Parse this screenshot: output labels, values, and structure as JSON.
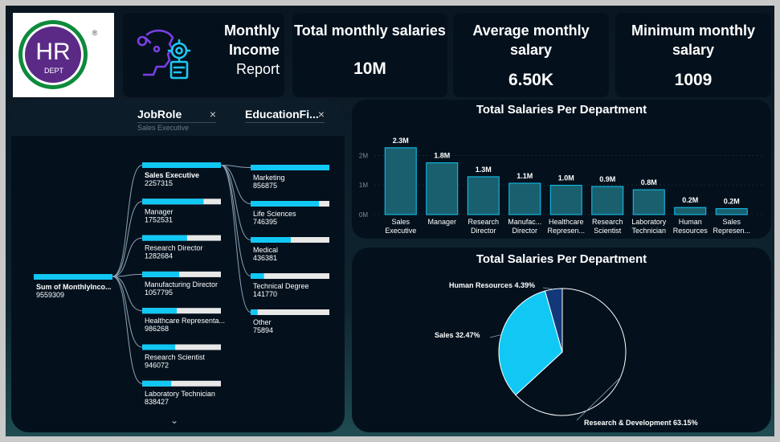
{
  "logo": {
    "text": "HR",
    "sub": "DEPT",
    "mark": "®"
  },
  "report_title": {
    "line1": "Monthly",
    "line2": "Income",
    "line3": "Report"
  },
  "kpis": [
    {
      "title_l1": "Total monthly salaries",
      "title_l2": "",
      "value": "10M"
    },
    {
      "title_l1": "Average monthly",
      "title_l2": "salary",
      "value": "6.50K"
    },
    {
      "title_l1": "Minimum monthly",
      "title_l2": "salary",
      "value": "1009"
    }
  ],
  "tree": {
    "col1_header": "JobRole",
    "col1_sub": "Sales Executive",
    "col2_header": "EducationFi...",
    "root": {
      "label": "Sum of MonthlyInco...",
      "value": "9559309"
    },
    "jobroles": [
      {
        "label": "Sales Executive",
        "value": "2257315",
        "fill": 1.0
      },
      {
        "label": "Manager",
        "value": "1752531",
        "fill": 0.78
      },
      {
        "label": "Research Director",
        "value": "1282684",
        "fill": 0.57
      },
      {
        "label": "Manufacturing Director",
        "value": "1057795",
        "fill": 0.47
      },
      {
        "label": "Healthcare Representa...",
        "value": "986268",
        "fill": 0.44
      },
      {
        "label": "Research Scientist",
        "value": "946072",
        "fill": 0.42
      },
      {
        "label": "Laboratory Technician",
        "value": "838427",
        "fill": 0.37
      }
    ],
    "education": [
      {
        "label": "Marketing",
        "value": "856875",
        "fill": 1.0
      },
      {
        "label": "Life Sciences",
        "value": "746395",
        "fill": 0.87
      },
      {
        "label": "Medical",
        "value": "436381",
        "fill": 0.51
      },
      {
        "label": "Technical Degree",
        "value": "141770",
        "fill": 0.17
      },
      {
        "label": "Other",
        "value": "75894",
        "fill": 0.09
      }
    ]
  },
  "chart_data": [
    {
      "type": "bar",
      "title": "Total Salaries Per Department",
      "categories": [
        [
          "Sales",
          "Executive"
        ],
        [
          "Manager"
        ],
        [
          "Research",
          "Director"
        ],
        [
          "Manufac...",
          "Director"
        ],
        [
          "Healthcare",
          "Represen..."
        ],
        [
          "Research",
          "Scientist"
        ],
        [
          "Laboratory",
          "Technician"
        ],
        [
          "Human",
          "Resources"
        ],
        [
          "Sales",
          "Represen..."
        ]
      ],
      "values": [
        2.26,
        1.75,
        1.28,
        1.06,
        0.99,
        0.95,
        0.84,
        0.24,
        0.2
      ],
      "data_labels": [
        "2.3M",
        "1.8M",
        "1.3M",
        "1.1M",
        "1.0M",
        "0.9M",
        "0.8M",
        "0.2M",
        "0.2M"
      ],
      "y_ticks": [
        "0M",
        "1M",
        "2M"
      ],
      "ylim": [
        0,
        2.5
      ]
    },
    {
      "type": "pie",
      "title": "Total Salaries Per Department",
      "slices": [
        {
          "label": "Research & Development 63.15%",
          "value": 63.15,
          "color": "#04111d"
        },
        {
          "label": "Sales 32.47%",
          "value": 32.47,
          "color": "#11c8f5"
        },
        {
          "label": "Human Resources 4.39%",
          "value": 4.39,
          "color": "#12387a"
        }
      ]
    }
  ],
  "colors": {
    "accent": "#11c8f5",
    "bar_fill": "#1a5f6e",
    "track": "#e8e8e8"
  },
  "icons": {
    "logo": "hr-logo",
    "report": "ai-robot-gear-icon",
    "expand": "chevron-down-icon"
  }
}
